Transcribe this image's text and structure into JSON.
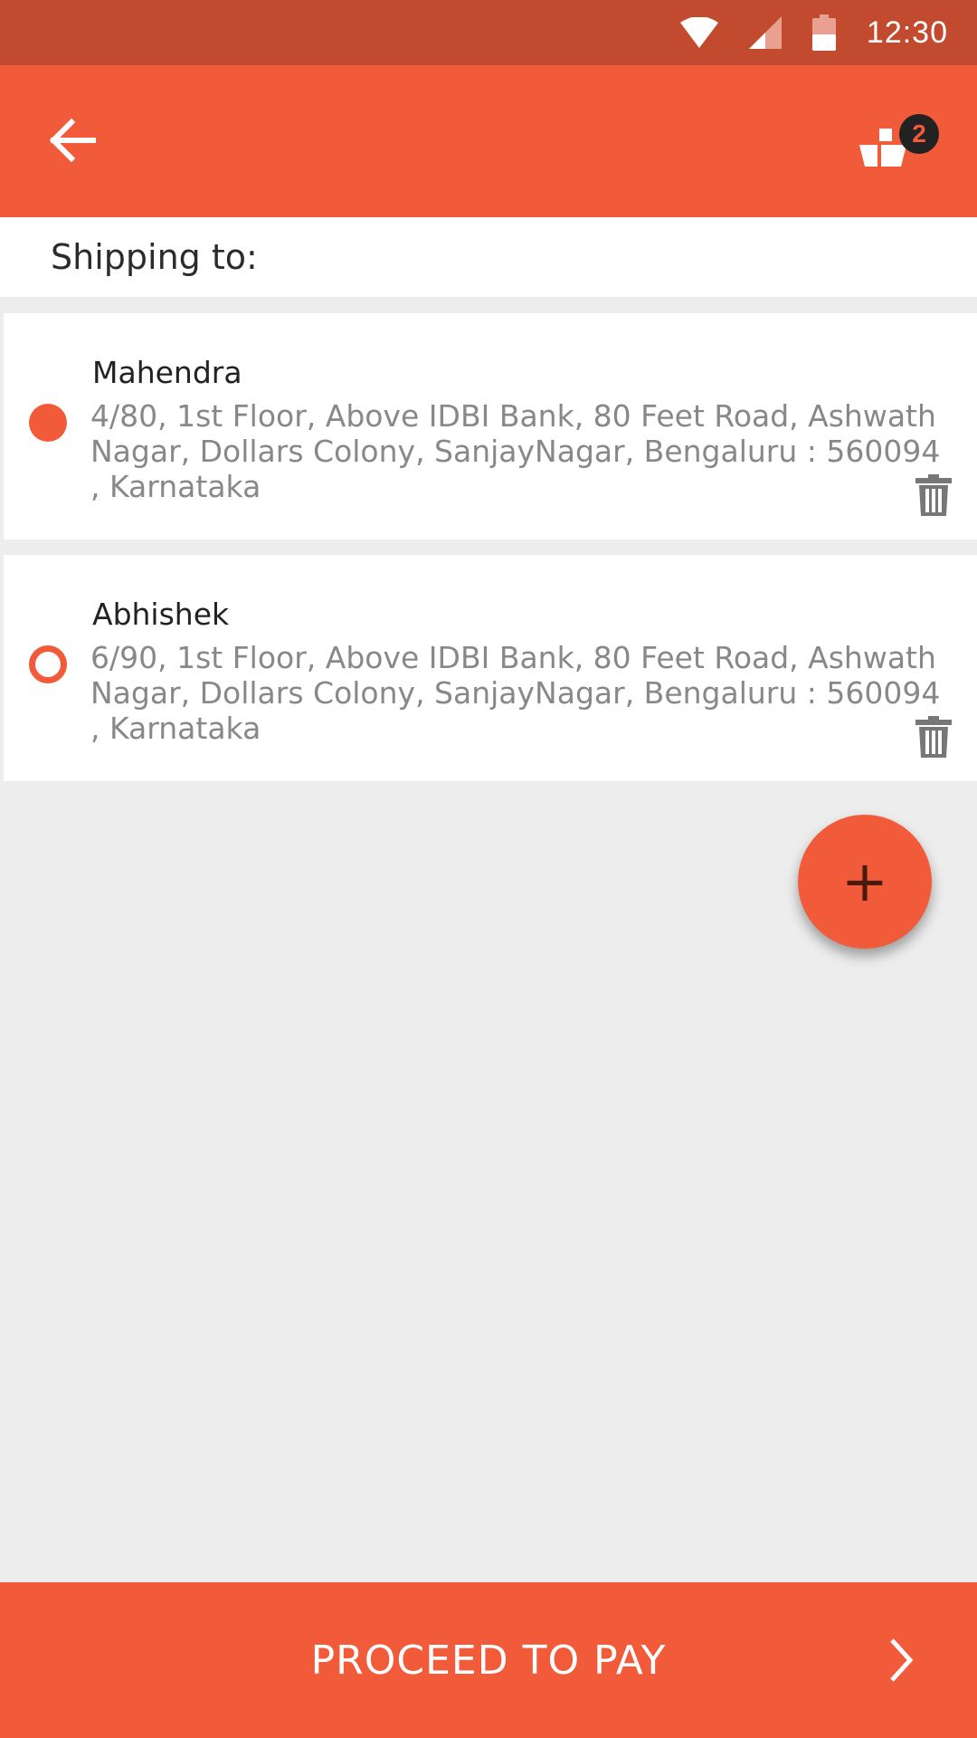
{
  "status_bar": {
    "time": "12:30"
  },
  "app_bar": {
    "cart_count": "2"
  },
  "shipping": {
    "header": "Shipping to:"
  },
  "addresses": [
    {
      "name": "Mahendra",
      "address": "4/80, 1st Floor, Above IDBI Bank, 80 Feet Road, Ashwath Nagar, Dollars Colony, SanjayNagar, Bengaluru : 560094 , Karnataka",
      "selected": true
    },
    {
      "name": "Abhishek",
      "address": "6/90, 1st Floor, Above IDBI Bank, 80 Feet Road, Ashwath Nagar, Dollars Colony, SanjayNagar, Bengaluru : 560094 , Karnataka",
      "selected": false
    }
  ],
  "fab": {
    "label": "+"
  },
  "footer": {
    "proceed_label": "PROCEED TO PAY"
  },
  "colors": {
    "accent": "#f15b3a",
    "status_bar": "#c24a2e",
    "background": "#ededed"
  },
  "icons": [
    "wifi-icon",
    "signal-icon",
    "battery-icon",
    "back-arrow-icon",
    "cart-icon",
    "trash-icon",
    "chevron-right-icon"
  ]
}
